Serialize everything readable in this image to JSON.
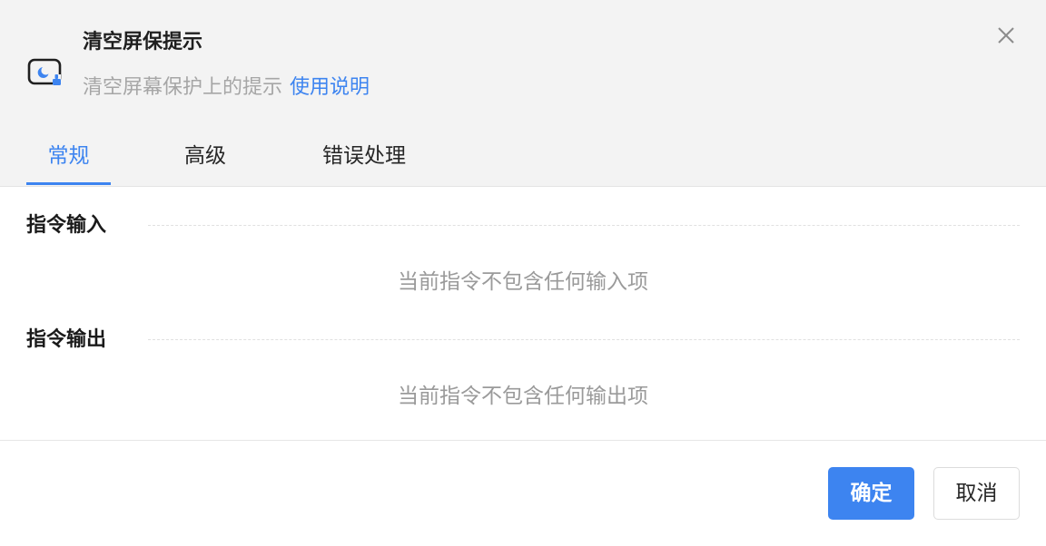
{
  "dialog": {
    "title": "清空屏保提示",
    "description": "清空屏幕保护上的提示",
    "help_link": "使用说明",
    "command_icon": "screensaver-clear-icon",
    "close_icon": "close-icon"
  },
  "tabs": [
    {
      "label": "常规",
      "active": true
    },
    {
      "label": "高级",
      "active": false
    },
    {
      "label": "错误处理",
      "active": false
    }
  ],
  "sections": {
    "input": {
      "title": "指令输入",
      "empty_text": "当前指令不包含任何输入项"
    },
    "output": {
      "title": "指令输出",
      "empty_text": "当前指令不包含任何输出项"
    }
  },
  "footer": {
    "confirm_label": "确定",
    "cancel_label": "取消"
  },
  "colors": {
    "accent": "#3d84f0",
    "header_bg": "#f3f3f3",
    "muted_text": "#9a9a9a"
  }
}
